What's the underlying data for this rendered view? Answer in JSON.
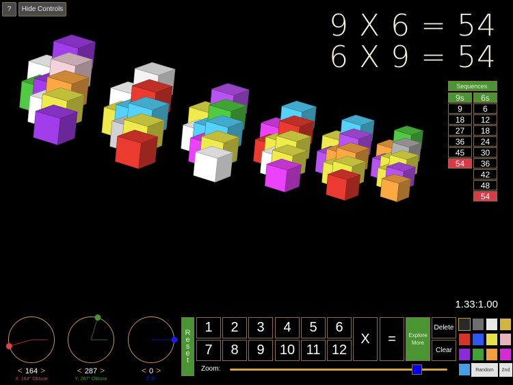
{
  "toolbar": {
    "help_label": "?",
    "hide_controls_label": "Hide Controls"
  },
  "equations": [
    {
      "a": "9",
      "op": "X",
      "b": "6",
      "eq": "=",
      "result": "54"
    },
    {
      "a": "6",
      "op": "X",
      "b": "9",
      "eq": "=",
      "result": "54"
    }
  ],
  "equation_text": [
    "9 X 6 = 54",
    "6 X 9 = 54"
  ],
  "sequences": {
    "title": "Sequences:",
    "columns": [
      {
        "header": "9s",
        "values": [
          "9",
          "18",
          "27",
          "36",
          "45",
          "54"
        ],
        "highlight_value": "54"
      },
      {
        "header": "6s",
        "values": [
          "6",
          "12",
          "18",
          "24",
          "30",
          "36",
          "42",
          "48",
          "54"
        ],
        "highlight_value": "54"
      }
    ],
    "highlight_color": "#d83a4a",
    "header_color": "#4a9434"
  },
  "aspect_ratio": "1.33:1.00",
  "rotation": {
    "x": {
      "value": "164",
      "caption": "X: 164° Obtuse",
      "color": "#e0404a",
      "angle_deg": 164
    },
    "y": {
      "value": "287",
      "caption": "Y: 287° Obtuse",
      "color": "#4a9434",
      "angle_deg": 287
    },
    "z": {
      "value": "0",
      "caption": "Z: 0°",
      "color": "#1a1aee",
      "angle_deg": 0
    },
    "decrement_label": "<",
    "increment_label": ">"
  },
  "keypad": {
    "reset_label": [
      "R",
      "e",
      "s",
      "e",
      "t"
    ],
    "numbers": [
      "1",
      "2",
      "3",
      "4",
      "5",
      "6",
      "7",
      "8",
      "9",
      "10",
      "11",
      "12"
    ],
    "times_label": "X",
    "equals_label": "=",
    "explore_label_1": "Explore",
    "explore_label_2": "More",
    "delete_label": "Delete",
    "clear_label": "Clear",
    "zoom_label": "Zoom:",
    "zoom_level": 0.86
  },
  "palette": {
    "colors": [
      "#2a2a2a",
      "#6e6e6e",
      "#e8e8e8",
      "#d4b43c",
      "#d8322a",
      "#2a58f0",
      "#e4e048",
      "#e4b4bc",
      "#8a2ad8",
      "#44a034",
      "#f0a040",
      "#d42ad8",
      "#44a0e0"
    ],
    "selected_index": 0,
    "random_label": "Random",
    "second_label": "2nd"
  },
  "theme": {
    "accent_green": "#4a9434",
    "border_gold": "#8a7340",
    "slider_gold": "#d8a444",
    "equation_color": "#f5f0dc"
  },
  "cube_stacks": {
    "multiplicand": 9,
    "multiplier": 6,
    "stack_colors": [
      [
        "#9a3ae0",
        "#e8c8d0",
        "#f0a040",
        "#e4e048",
        "#9a3ae0",
        "#ffffff",
        "#9a3ae0",
        "#4cc040",
        "#ffffff"
      ],
      [
        "#e8e8e8",
        "#e0382e",
        "#50c8f0",
        "#e4e048",
        "#e0382e",
        "#c8c8c8",
        "#50c8f0",
        "#e4e048",
        "#ffffff"
      ],
      [
        "#b050e8",
        "#4cc040",
        "#50c8f0",
        "#e4e048",
        "#ffffff",
        "#e040f0",
        "#50c8f0",
        "#ffffff",
        "#e4e048"
      ],
      [
        "#50c8f0",
        "#e0382e",
        "#e4e048",
        "#e4e048",
        "#e040f0",
        "#ffffff",
        "#e4e048",
        "#e0382e",
        "#e040f0"
      ],
      [
        "#50c8f0",
        "#b050e8",
        "#f0a040",
        "#e4e048",
        "#e0382e",
        "#e4e048",
        "#f0a040",
        "#b050e8",
        "#e4e048"
      ],
      [
        "#4cc040",
        "#a8a8a8",
        "#e4e048",
        "#b050e8",
        "#f0a040",
        "#e4e048",
        "#e4e048",
        "#b050e8",
        "#f0a040"
      ]
    ]
  }
}
